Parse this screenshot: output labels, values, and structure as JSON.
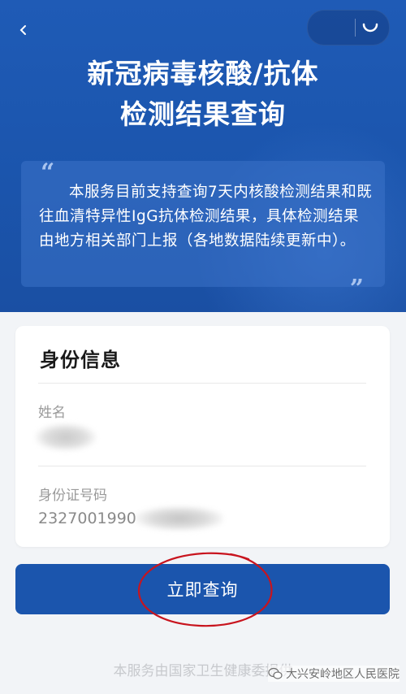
{
  "header": {
    "title_line1": "新冠病毒核酸/抗体",
    "title_line2": "检测结果查询",
    "notice": "本服务目前支持查询7天内核酸检测结果和既往血清特异性IgG抗体检测结果，具体检测结果由地方相关部门上报（各地数据陆续更新中）。",
    "quote_open": "“",
    "quote_close": "”"
  },
  "identity_card": {
    "title": "身份信息",
    "name_label": "姓名",
    "name_value": "",
    "id_label": "身份证号码",
    "id_value": "2327001990"
  },
  "query_button_label": "立即查询",
  "footer_text": "本服务由国家卫生健康委提供",
  "watermark_text": "大兴安岭地区人民医院",
  "colors": {
    "primary": "#1b55ad",
    "annotation": "#c8141e"
  },
  "icons": [
    "back-icon",
    "close-icon",
    "wechat-icon"
  ]
}
